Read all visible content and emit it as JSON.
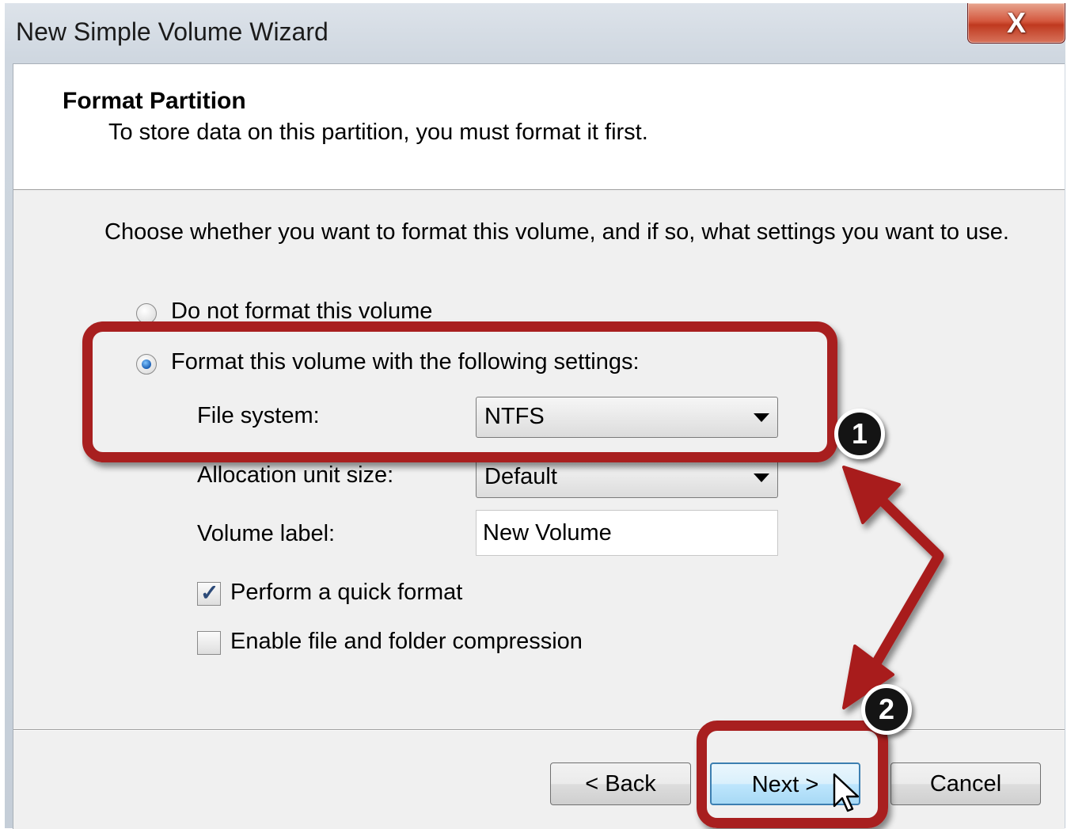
{
  "window": {
    "title": "New Simple Volume Wizard",
    "close_label": "X"
  },
  "header": {
    "title": "Format Partition",
    "subtitle": "To store data on this partition, you must format it first."
  },
  "instruction": "Choose whether you want to format this volume, and if so, what settings you want to use.",
  "options": {
    "no_format": {
      "label": "Do not format this volume",
      "selected": false
    },
    "format": {
      "label": "Format this volume with the following settings:",
      "selected": true
    }
  },
  "fields": {
    "file_system": {
      "label": "File system:",
      "value": "NTFS"
    },
    "allocation_unit_size": {
      "label": "Allocation unit size:",
      "value": "Default"
    },
    "volume_label": {
      "label": "Volume label:",
      "value": "New Volume"
    }
  },
  "checkboxes": {
    "quick_format": {
      "label": "Perform a quick format",
      "checked": true
    },
    "compression": {
      "label": "Enable file and folder compression",
      "checked": false
    }
  },
  "buttons": {
    "back": "< Back",
    "next": "Next >",
    "cancel": "Cancel"
  },
  "annotations": {
    "badge_1": "1",
    "badge_2": "2",
    "highlight_color": "#a81f1f"
  }
}
